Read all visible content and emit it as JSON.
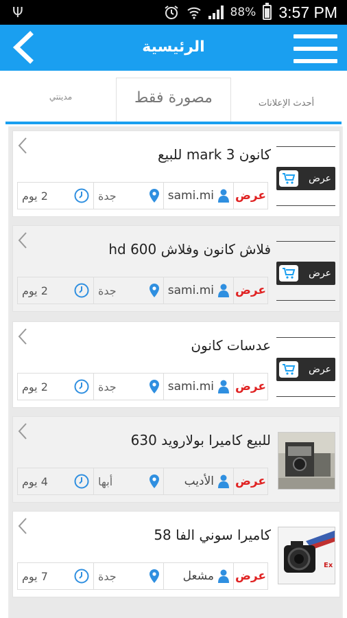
{
  "status_bar": {
    "battery_percent": "88%",
    "time": "3:57 PM",
    "icons": [
      "usb-icon",
      "alarm-icon",
      "wifi-icon",
      "signal-icon",
      "battery-icon"
    ]
  },
  "app_bar": {
    "title": "الرئيسية",
    "color": "#1a9ff0"
  },
  "tabs": [
    {
      "label": "مدينتي"
    },
    {
      "label": "مصورة فقط"
    },
    {
      "label": "أحدث الإعلانات",
      "active": true
    }
  ],
  "listings": [
    {
      "title": "كانون mark 3 للبيع",
      "offer_badge": "عرض",
      "type_label": "عرض",
      "user": "sami.mi",
      "city": "جدة",
      "age": "2 يوم"
    },
    {
      "title": "فلاش كانون وفلاش 600 hd",
      "offer_badge": "عرض",
      "type_label": "عرض",
      "user": "sami.mi",
      "city": "جدة",
      "age": "2 يوم"
    },
    {
      "title": "عدسات كانون",
      "offer_badge": "عرض",
      "type_label": "عرض",
      "user": "sami.mi",
      "city": "جدة",
      "age": "2 يوم"
    },
    {
      "title": "للبيع كاميرا بولارويد 630",
      "type_label": "عرض",
      "user": "الأديب",
      "city": "أبها",
      "age": "4 يوم"
    },
    {
      "title": "كاميرا سوني الفا 58",
      "type_label": "عرض",
      "user": "مشعل",
      "city": "جدة",
      "age": "7 يوم"
    }
  ]
}
